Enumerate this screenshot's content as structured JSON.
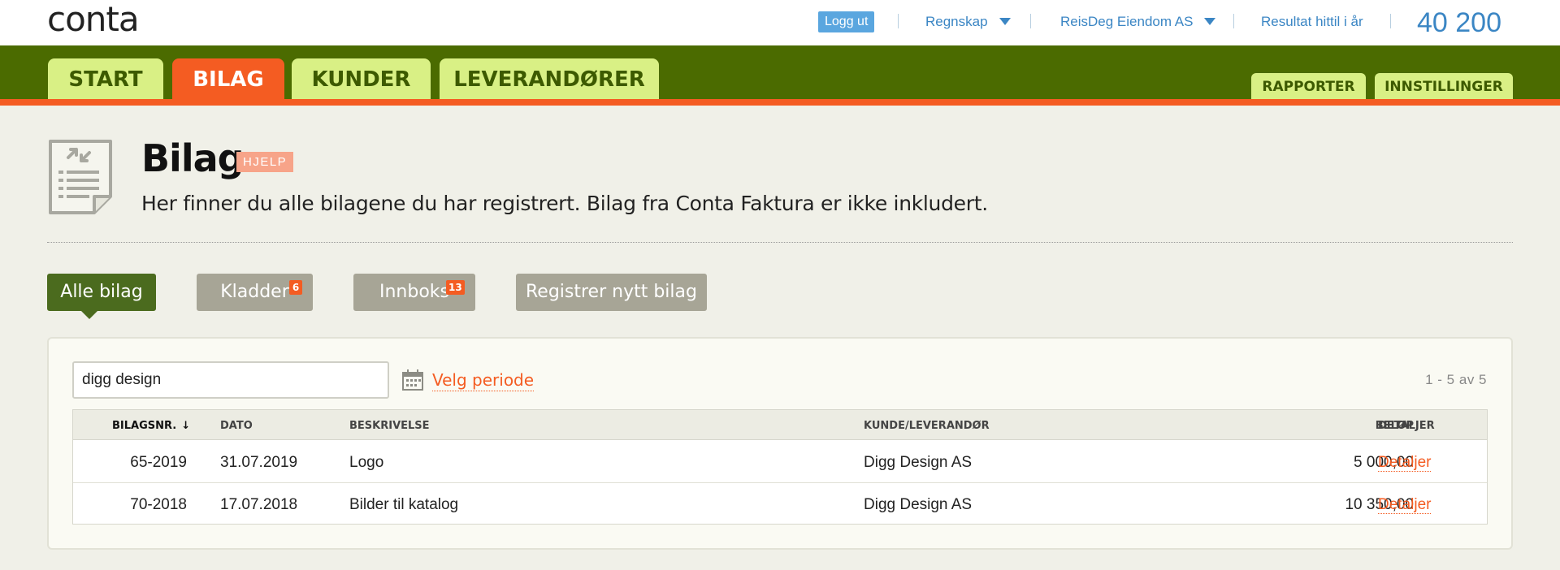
{
  "topbar": {
    "logo": "conta",
    "logout_label": "Logg ut",
    "regnskap_label": "Regnskap",
    "company_label": "ReisDeg Eiendom AS",
    "result_label": "Resultat hittil i år",
    "result_value": "40 200"
  },
  "nav": {
    "tabs": [
      {
        "label": "START"
      },
      {
        "label": "BILAG"
      },
      {
        "label": "KUNDER"
      },
      {
        "label": "LEVERANDØRER"
      }
    ],
    "active_tab": "BILAG",
    "right_tabs": [
      {
        "label": "RAPPORTER"
      },
      {
        "label": "INNSTILLINGER"
      }
    ]
  },
  "header": {
    "title": "Bilag",
    "help_label": "HJELP",
    "subtitle": "Her finner du alle bilagene du har registrert. Bilag fra Conta Faktura er ikke inkludert."
  },
  "subnav": {
    "all_label": "Alle bilag",
    "drafts_label": "Kladder",
    "drafts_count": "6",
    "inbox_label": "Innboks",
    "inbox_count": "13",
    "register_label": "Registrer nytt bilag"
  },
  "filter": {
    "search_value": "digg design",
    "period_label": "Velg periode",
    "count_text": "1 - 5  av 5"
  },
  "table": {
    "columns": [
      "BILAGSNR.",
      "DATO",
      "BESKRIVELSE",
      "KUNDE/LEVERANDØR",
      "BELØP",
      "DETALJER"
    ],
    "sort_icon": "arrow-down-icon",
    "rows": [
      {
        "nr": "65-2019",
        "date": "31.07.2019",
        "description": "Logo",
        "party": "Digg Design AS",
        "amount": "5 000,00",
        "details": "Detaljer"
      },
      {
        "nr": "70-2018",
        "date": "17.07.2018",
        "description": "Bilder til katalog",
        "party": "Digg Design AS",
        "amount": "10 350,00",
        "details": "Detaljer"
      }
    ]
  },
  "colors": {
    "nav_green": "#4b6b00",
    "tab_lime": "#d9f085",
    "accent_orange": "#f45c22",
    "link_blue": "#3b86c4",
    "button_gray": "#a7a596",
    "active_button": "#4b6b1e"
  }
}
